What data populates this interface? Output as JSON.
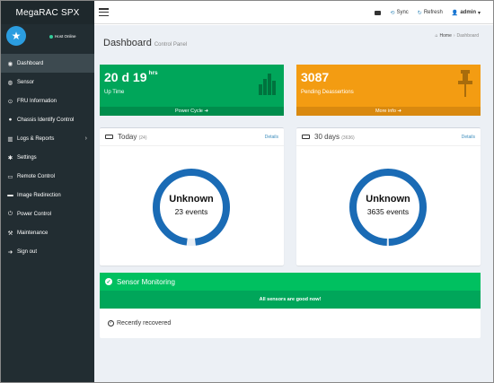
{
  "sidebar": {
    "brand": "MegaRAC SPX",
    "host_status": "Host Online",
    "items": [
      {
        "label": "Dashboard",
        "icon": "dashboard-icon"
      },
      {
        "label": "Sensor",
        "icon": "sensor-icon"
      },
      {
        "label": "FRU Information",
        "icon": "info-icon"
      },
      {
        "label": "Chassis Identify Control",
        "icon": "identify-icon"
      },
      {
        "label": "Logs & Reports",
        "icon": "chart-icon",
        "arrow": "›"
      },
      {
        "label": "Settings",
        "icon": "gear-icon"
      },
      {
        "label": "Remote Control",
        "icon": "monitor-icon"
      },
      {
        "label": "Image Redirection",
        "icon": "disc-icon"
      },
      {
        "label": "Power Control",
        "icon": "power-icon"
      },
      {
        "label": "Maintenance",
        "icon": "wrench-icon"
      },
      {
        "label": "Sign out",
        "icon": "signout-icon"
      }
    ]
  },
  "header": {
    "sync_label": "Sync",
    "refresh_label": "Refresh",
    "user_label": "admin",
    "user_caret": "▾"
  },
  "page": {
    "title": "Dashboard",
    "subtitle": "Control Panel",
    "breadcrumb_home": "Home",
    "breadcrumb_sep": "›",
    "breadcrumb_current": "Dashboard"
  },
  "uptime_box": {
    "value": "20 d 19",
    "unit": "hrs",
    "label": "Up Time",
    "footer": "Power Cycle"
  },
  "deassert_box": {
    "value": "3087",
    "label": "Pending Deassertions",
    "footer": "More info"
  },
  "today": {
    "title": "Today",
    "count": "(24)",
    "details": "Details",
    "center_main": "Unknown",
    "center_sub": "23 events",
    "ring_fraction": 0.96
  },
  "thirty_days": {
    "title": "30 days",
    "count": "(3636)",
    "details": "Details",
    "center_main": "Unknown",
    "center_sub": "3635 events",
    "ring_fraction": 0.997
  },
  "sensor": {
    "title": "Sensor Monitoring",
    "status": "All sensors are good now!",
    "recent": "Recently recovered"
  },
  "colors": {
    "sidebar": "#222d32",
    "green": "#00a65a",
    "orange": "#f39c12",
    "ring": "#1a6bb5",
    "accent": "#3c8dbc"
  }
}
